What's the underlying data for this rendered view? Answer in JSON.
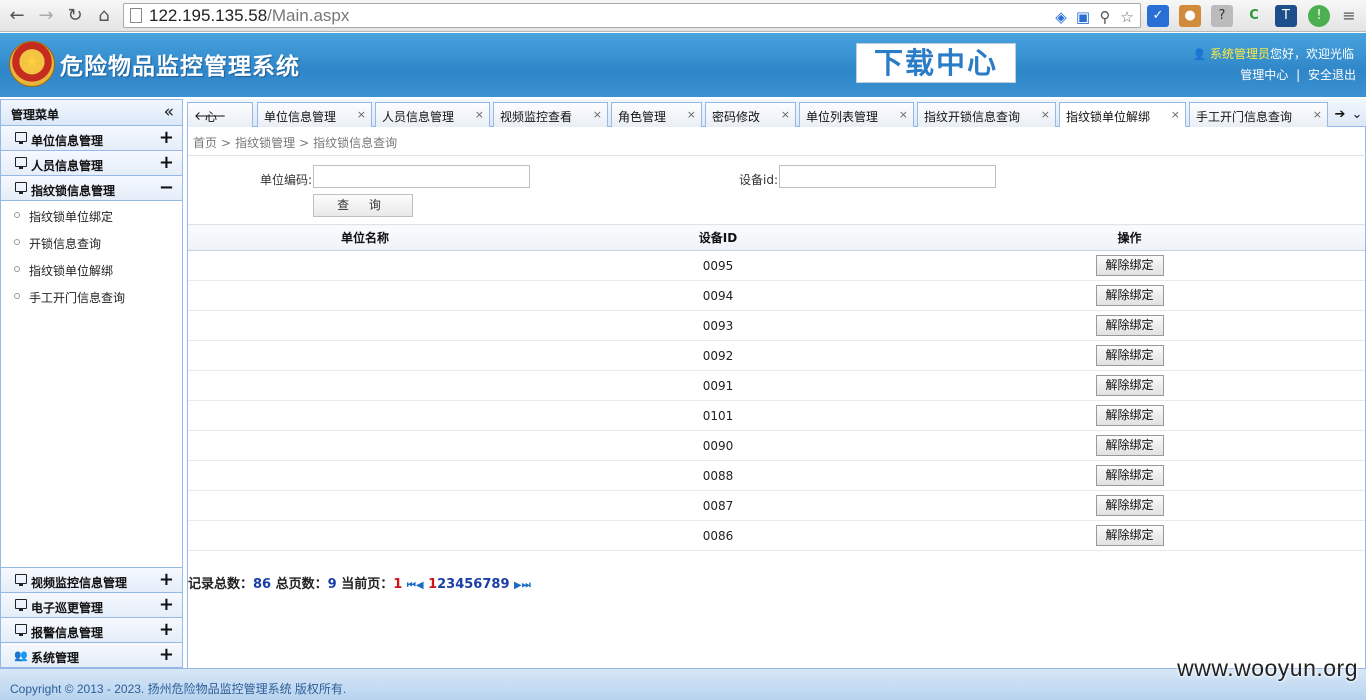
{
  "browser": {
    "url_host": "122.195.135.58",
    "url_path": "/Main.aspx"
  },
  "header": {
    "title": "危险物品监控管理系统",
    "download_banner": "下载中心",
    "user_name": "系统管理员",
    "greeting": "您好，欢迎光临",
    "link_admin": "管理中心",
    "link_sep": "|",
    "link_logout": "安全退出"
  },
  "sidebar": {
    "title": "管理菜单",
    "collapse_glyph": "«",
    "groups_top": [
      {
        "label": "单位信息管理",
        "state": "+"
      },
      {
        "label": "人员信息管理",
        "state": "+"
      },
      {
        "label": "指纹锁信息管理",
        "state": "−"
      }
    ],
    "sub_items": [
      {
        "label": "指纹锁单位绑定"
      },
      {
        "label": "开锁信息查询"
      },
      {
        "label": "指纹锁单位解绑"
      },
      {
        "label": "手工开门信息查询"
      }
    ],
    "groups_bottom": [
      {
        "label": "视频监控信息管理",
        "state": "+"
      },
      {
        "label": "电子巡更管理",
        "state": "+"
      },
      {
        "label": "报警信息管理",
        "state": "+"
      },
      {
        "label": "系统管理",
        "state": "+"
      }
    ]
  },
  "tabs": [
    {
      "label": "心",
      "closable": false
    },
    {
      "label": "单位信息管理",
      "closable": true
    },
    {
      "label": "人员信息管理",
      "closable": true
    },
    {
      "label": "视频监控查看",
      "closable": true
    },
    {
      "label": "角色管理",
      "closable": true
    },
    {
      "label": "密码修改",
      "closable": true
    },
    {
      "label": "单位列表管理",
      "closable": true
    },
    {
      "label": "指纹开锁信息查询",
      "closable": true
    },
    {
      "label": "指纹锁单位解绑",
      "closable": true,
      "active": true
    },
    {
      "label": "手工开门信息查询",
      "closable": true
    }
  ],
  "tab_close_glyph": "×",
  "breadcrumb": {
    "home": "首页",
    "level1": "指纹锁管理",
    "level2": "指纹锁信息查询",
    "sep": ">"
  },
  "form": {
    "unit_code_label": "单位编码:",
    "unit_code_value": "",
    "device_id_label": "设备id:",
    "device_id_value": "",
    "query_button": "查 询"
  },
  "table": {
    "columns": [
      "单位名称",
      "设备ID",
      "操作"
    ],
    "action_label": "解除绑定",
    "rows": [
      {
        "unit_name": "",
        "device_id": "0095"
      },
      {
        "unit_name": "",
        "device_id": "0094"
      },
      {
        "unit_name": "",
        "device_id": "0093"
      },
      {
        "unit_name": "",
        "device_id": "0092"
      },
      {
        "unit_name": "",
        "device_id": "0091"
      },
      {
        "unit_name": "",
        "device_id": "0101"
      },
      {
        "unit_name": "",
        "device_id": "0090"
      },
      {
        "unit_name": "",
        "device_id": "0088"
      },
      {
        "unit_name": "",
        "device_id": "0087"
      },
      {
        "unit_name": "",
        "device_id": "0086"
      }
    ]
  },
  "pager": {
    "total_label": "记录总数：",
    "total": "86",
    "pages_label": "总页数：",
    "pages": "9",
    "current_label": "当前页：",
    "current": "1",
    "page_links": [
      "1",
      "2",
      "3",
      "4",
      "5",
      "6",
      "7",
      "8",
      "9"
    ]
  },
  "footer": {
    "copyright": "Copyright © 2013 - 2023. 扬州危险物品监控管理系统 版权所有."
  },
  "watermark": "www.wooyun.org"
}
